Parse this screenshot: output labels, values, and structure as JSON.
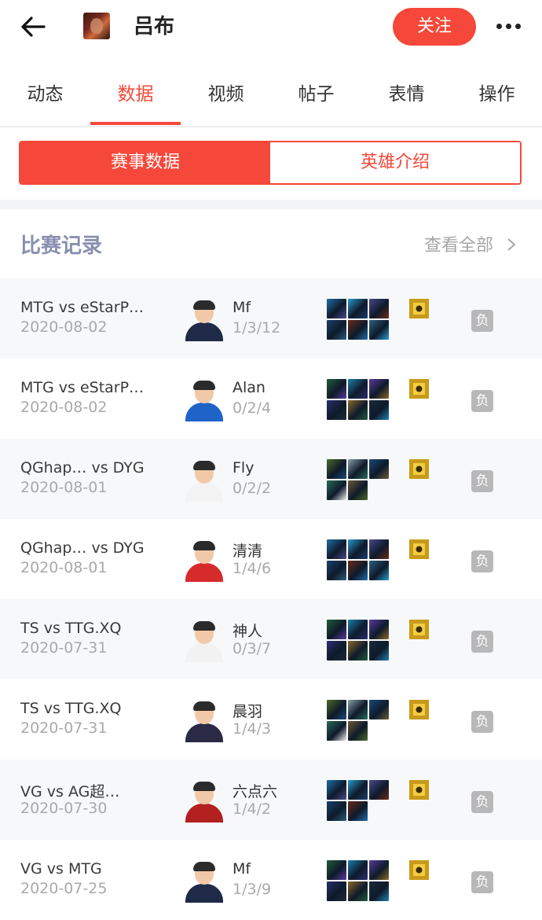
{
  "header": {
    "hero_name": "吕布",
    "follow_label": "关注",
    "back_icon": "arrow-left-icon",
    "more_icon": "more-dots-icon"
  },
  "tabs": [
    {
      "label": "动态",
      "active": false
    },
    {
      "label": "数据",
      "active": true
    },
    {
      "label": "视频",
      "active": false
    },
    {
      "label": "帖子",
      "active": false
    },
    {
      "label": "表情",
      "active": false
    },
    {
      "label": "操作",
      "active": false
    }
  ],
  "segment": {
    "left": "赛事数据",
    "right": "英雄介绍"
  },
  "section": {
    "title": "比赛记录",
    "more": "查看全部"
  },
  "colors": {
    "accent": "#f5483a",
    "section_title": "#8a8fb0",
    "loss_badge": "#b8b8b8"
  },
  "matches": [
    {
      "match": "MTG vs eStarP…",
      "date": "2020-08-02",
      "player": "Mf",
      "kda": "1/3/12",
      "result": "负",
      "items": 6,
      "jersey": "#1e2a48"
    },
    {
      "match": "MTG vs eStarP…",
      "date": "2020-08-02",
      "player": "Alan",
      "kda": "0/2/4",
      "result": "负",
      "items": 6,
      "jersey": "#1f63c9"
    },
    {
      "match": "QGhap… vs DYG",
      "date": "2020-08-01",
      "player": "Fly",
      "kda": "0/2/2",
      "result": "负",
      "items": 5,
      "jersey": "#f3f3f3"
    },
    {
      "match": "QGhap… vs DYG",
      "date": "2020-08-01",
      "player": "清清",
      "kda": "1/4/6",
      "result": "负",
      "items": 6,
      "jersey": "#d62b2b"
    },
    {
      "match": "TS vs TTG.XQ",
      "date": "2020-07-31",
      "player": "神人",
      "kda": "0/3/7",
      "result": "负",
      "items": 6,
      "jersey": "#f2f2f2"
    },
    {
      "match": "TS vs TTG.XQ",
      "date": "2020-07-31",
      "player": "晨羽",
      "kda": "1/4/3",
      "result": "负",
      "items": 5,
      "jersey": "#2a2a44"
    },
    {
      "match": "VG vs AG超…",
      "date": "2020-07-30",
      "player": "六点六",
      "kda": "1/4/2",
      "result": "负",
      "items": 5,
      "jersey": "#b32020"
    },
    {
      "match": "VG vs MTG",
      "date": "2020-07-25",
      "player": "Mf",
      "kda": "1/3/9",
      "result": "负",
      "items": 6,
      "jersey": "#1e2a48"
    }
  ]
}
